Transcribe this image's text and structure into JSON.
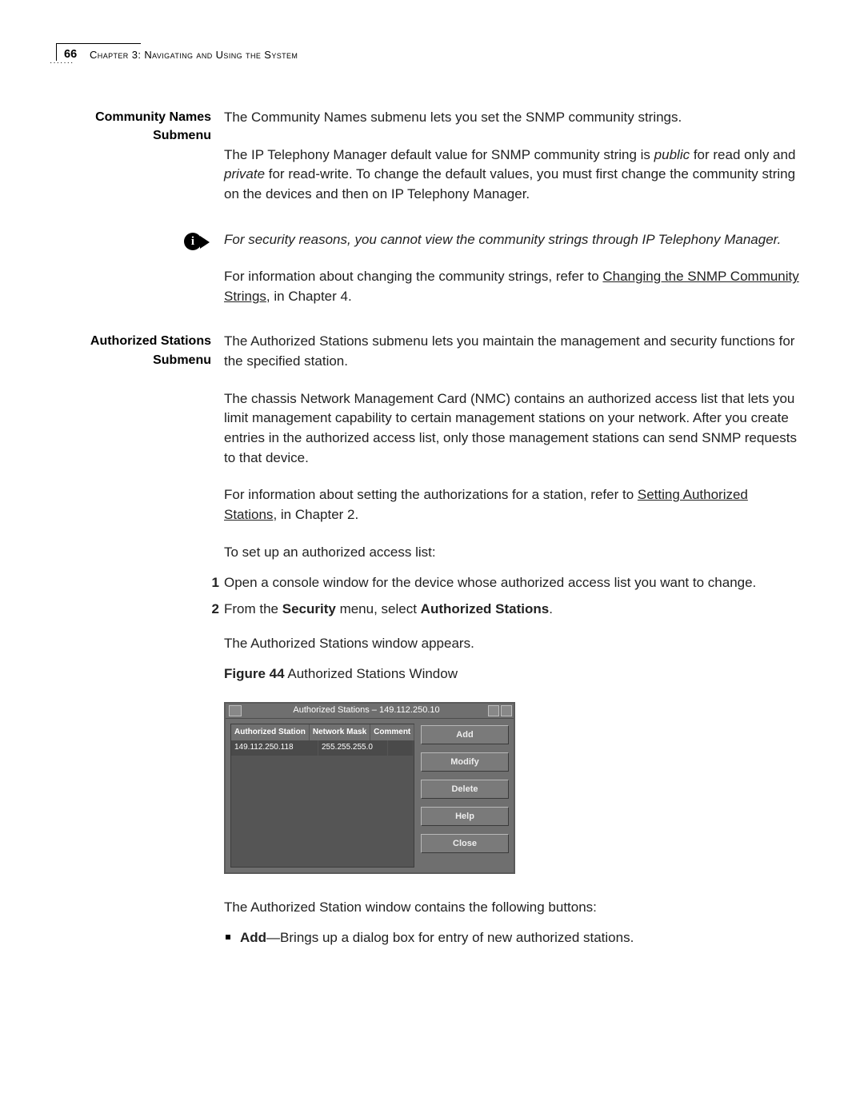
{
  "header": {
    "page_number": "66",
    "chapter_label": "Chapter 3: Navigating and Using the System"
  },
  "sections": {
    "community": {
      "side_l1": "Community Names",
      "side_l2": "Submenu",
      "p1": "The Community Names submenu lets you set the SNMP community strings.",
      "p2a": "The IP Telephony Manager default value for SNMP community string is ",
      "p2b": "public",
      "p2c": " for read only and ",
      "p2d": "private",
      "p2e": " for read-write. To change the default values, you must first change the community string on the devices and then on IP Telephony Manager.",
      "note": "For security reasons, you cannot view the community strings through IP Telephony Manager.",
      "p3a": "For information about changing the community strings, refer to ",
      "p3link": "Changing the SNMP Community Strings",
      "p3b": ", in Chapter 4."
    },
    "auth": {
      "side_l1": "Authorized Stations",
      "side_l2": "Submenu",
      "p1": "The Authorized Stations submenu lets you maintain the management and security functions for the specified station.",
      "p2": "The chassis Network Management Card (NMC) contains an authorized access list that lets you limit management capability to certain management stations on your network. After you create entries in the authorized access list, only those management stations can send SNMP requests to that device.",
      "p3a": "For information about setting the authorizations for a station, refer to ",
      "p3link": "Setting Authorized Stations",
      "p3b": ", in Chapter 2.",
      "p4": "To set up an authorized access list:",
      "steps": [
        {
          "num": "1",
          "text": "Open a console window for the device whose authorized access list you want to change."
        },
        {
          "num": "2",
          "pre": "From the ",
          "b1": "Security",
          "mid": " menu, select ",
          "b2": "Authorized Stations",
          "post": "."
        }
      ],
      "p5": "The Authorized Stations window appears.",
      "figcap_b": "Figure 44",
      "figcap_t": "  Authorized Stations Window",
      "p6": "The Authorized Station window contains the following buttons:",
      "bullet": {
        "b": "Add",
        "text": "—Brings up a dialog box for entry of new authorized stations."
      }
    }
  },
  "figure_window": {
    "title": "Authorized Stations – 149.112.250.10",
    "columns": [
      "Authorized Station",
      "Network Mask",
      "Comment"
    ],
    "rows": [
      {
        "station": "149.112.250.118",
        "mask": "255.255.255.0",
        "comment": ""
      }
    ],
    "buttons": [
      "Add",
      "Modify",
      "Delete",
      "Help",
      "Close"
    ]
  }
}
